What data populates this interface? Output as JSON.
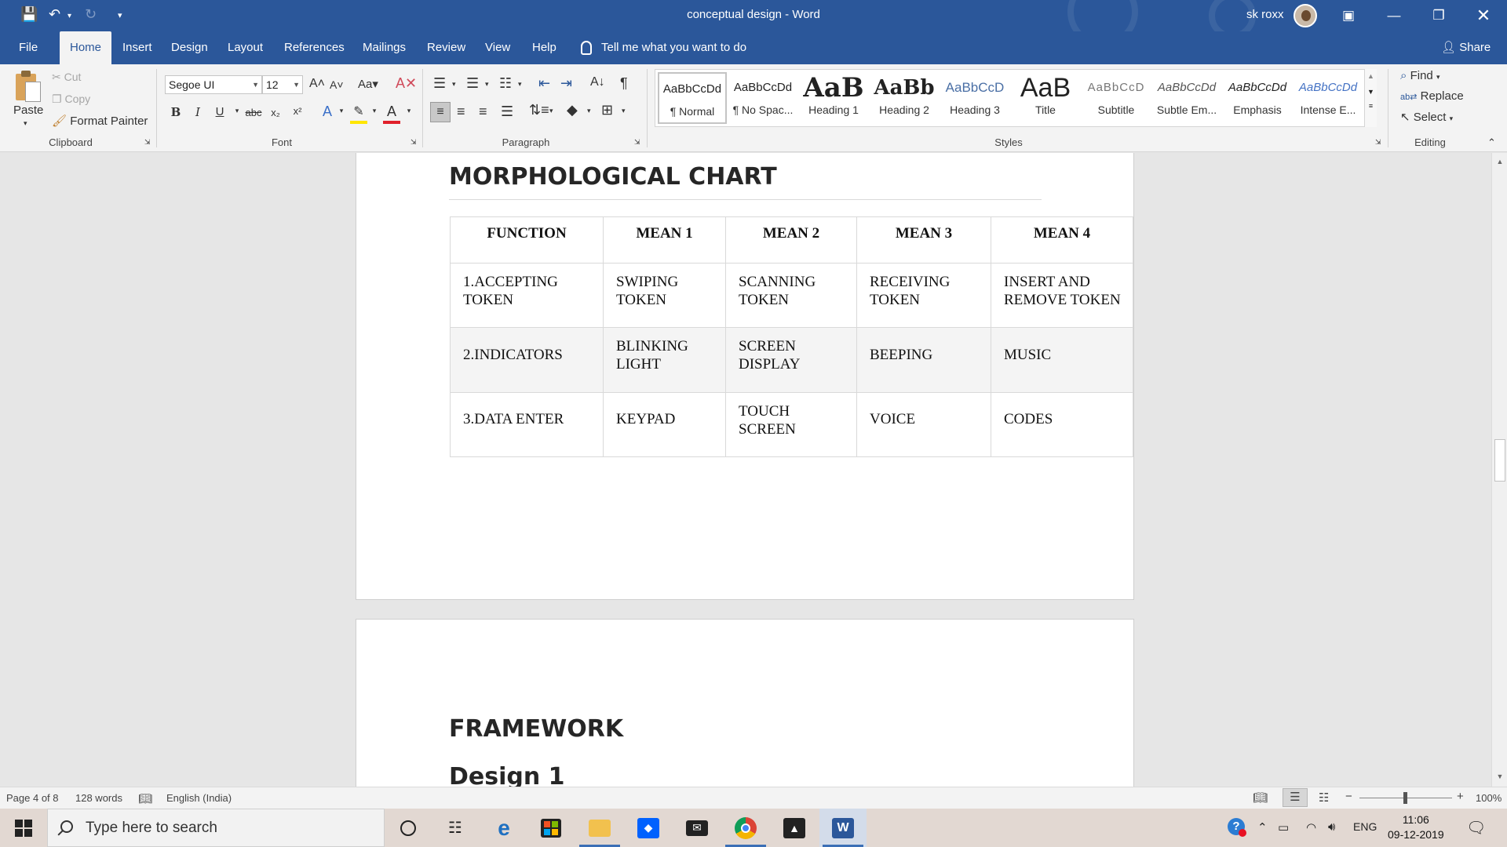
{
  "window": {
    "doc_title": "conceptual design  -  Word",
    "user_name": "sk roxx"
  },
  "menu": {
    "tabs": [
      "File",
      "Home",
      "Insert",
      "Design",
      "Layout",
      "References",
      "Mailings",
      "Review",
      "View",
      "Help"
    ],
    "tell_me": "Tell me what you want to do",
    "share": "Share"
  },
  "ribbon": {
    "clipboard": {
      "paste": "Paste",
      "cut": "Cut",
      "copy": "Copy",
      "format_painter": "Format Painter",
      "label": "Clipboard"
    },
    "font": {
      "name": "Segoe UI",
      "size": "12",
      "label": "Font"
    },
    "paragraph": {
      "label": "Paragraph"
    },
    "styles": {
      "label": "Styles",
      "items": [
        {
          "sample": "AaBbCcDd",
          "name": "¶ Normal"
        },
        {
          "sample": "AaBbCcDd",
          "name": "¶ No Spac..."
        },
        {
          "sample": "AaB",
          "name": "Heading 1"
        },
        {
          "sample": "AaBb",
          "name": "Heading 2"
        },
        {
          "sample": "AaBbCcD",
          "name": "Heading 3"
        },
        {
          "sample": "AaB",
          "name": "Title"
        },
        {
          "sample": "AaBbCcD",
          "name": "Subtitle"
        },
        {
          "sample": "AaBbCcDd",
          "name": "Subtle Em..."
        },
        {
          "sample": "AaBbCcDd",
          "name": "Emphasis"
        },
        {
          "sample": "AaBbCcDd",
          "name": "Intense E..."
        }
      ]
    },
    "editing": {
      "find": "Find",
      "replace": "Replace",
      "select": "Select",
      "label": "Editing"
    }
  },
  "document": {
    "heading_morph": "MORPHOLOGICAL CHART",
    "table": {
      "headers": [
        "FUNCTION",
        "MEAN 1",
        "MEAN 2",
        "MEAN 3",
        "MEAN 4"
      ],
      "rows": [
        [
          "1.ACCEPTING TOKEN",
          "SWIPING TOKEN",
          "SCANNING TOKEN",
          "RECEIVING TOKEN",
          "INSERT AND REMOVE TOKEN"
        ],
        [
          "2.INDICATORS",
          "BLINKING LIGHT",
          "SCREEN DISPLAY",
          "BEEPING",
          "MUSIC"
        ],
        [
          "3.DATA ENTER",
          "KEYPAD",
          "TOUCH SCREEN",
          "VOICE",
          "CODES"
        ]
      ]
    },
    "heading_framework": "FRAMEWORK",
    "heading_design": "Design 1"
  },
  "status": {
    "page": "Page 4 of 8",
    "words": "128 words",
    "language": "English (India)",
    "zoom": "100%"
  },
  "taskbar": {
    "search_placeholder": "Type here to search",
    "lang": "ENG",
    "time": "11:06",
    "date": "09-12-2019"
  },
  "colors": {
    "word_blue": "#2b579a",
    "ribbon_bg": "#f3f3f3",
    "canvas_bg": "#e6e6e6"
  }
}
